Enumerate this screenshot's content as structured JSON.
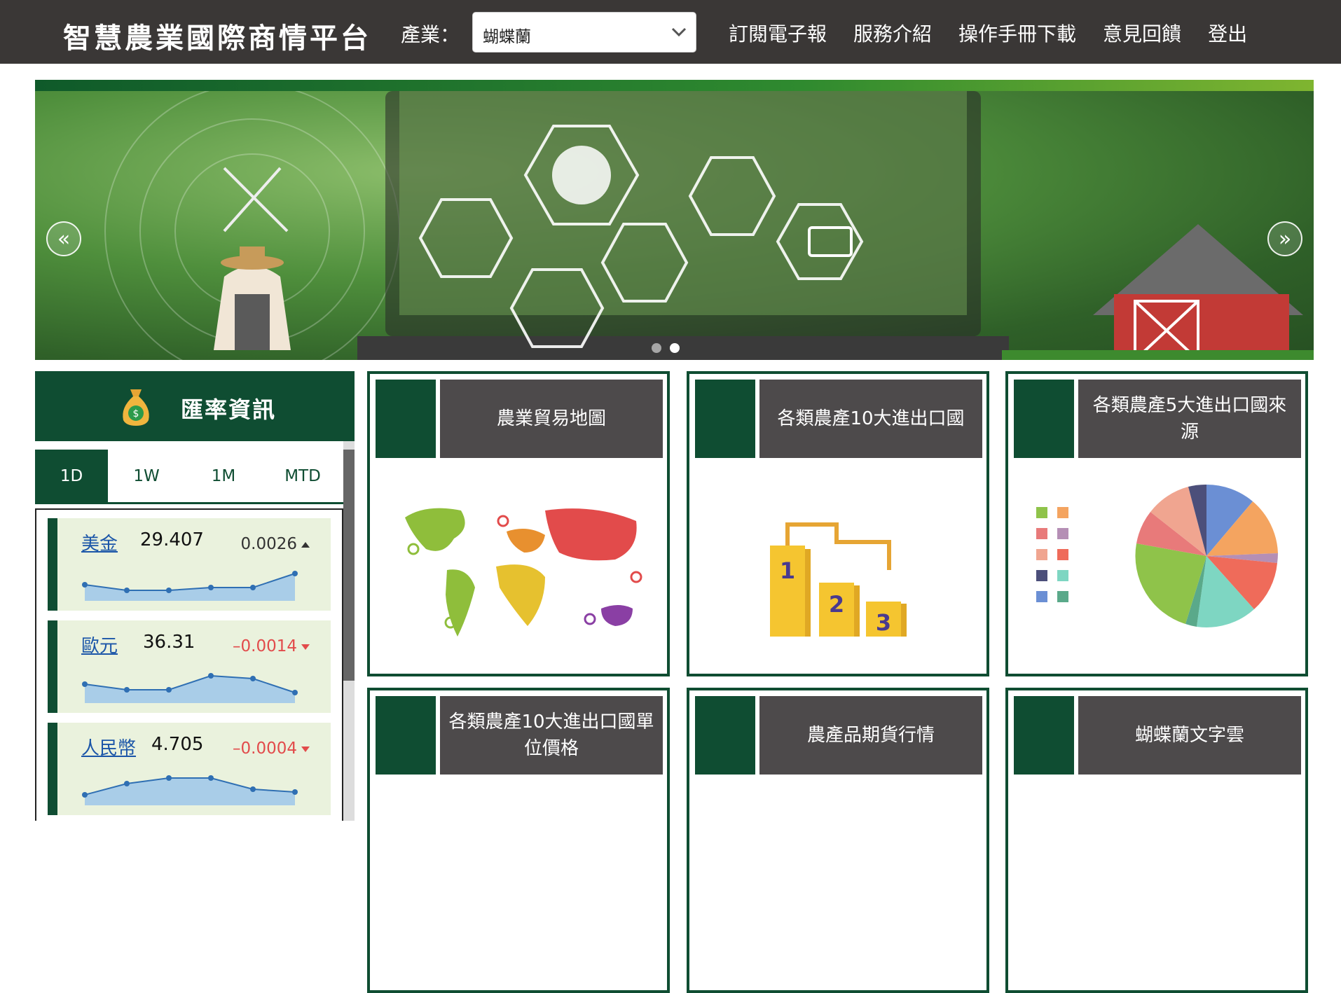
{
  "navbar": {
    "brand": "智慧農業國際商情平台",
    "industry_label": "產業：",
    "industry_value": "蝴蝶蘭",
    "links": [
      "訂閱電子報",
      "服務介紹",
      "操作手冊下載",
      "意見回饋",
      "登出"
    ]
  },
  "carousel": {
    "prev_icon": "«",
    "next_icon": "»",
    "slides": 2,
    "active_slide": 2
  },
  "fx": {
    "title": "匯率資訊",
    "tabs": [
      "1D",
      "1W",
      "1M",
      "MTD"
    ],
    "active_tab": "1D",
    "items": [
      {
        "currency": "美金",
        "rate": "29.407",
        "change": "0.0026",
        "direction": "up",
        "change_color": "#333333",
        "spark": [
          5,
          3,
          3,
          4,
          4,
          9
        ]
      },
      {
        "currency": "歐元",
        "rate": "36.31",
        "change": "–0.0014",
        "direction": "down",
        "change_color": "#e24b4b",
        "spark": [
          6,
          4,
          4,
          9,
          8,
          3
        ]
      },
      {
        "currency": "人民幣",
        "rate": "4.705",
        "change": "–0.0004",
        "direction": "down",
        "change_color": "#e24b4b",
        "spark": [
          3,
          7,
          9,
          9,
          5,
          4
        ]
      }
    ]
  },
  "cards": [
    {
      "title": "農業貿易地圖",
      "icon": "world-map-icon"
    },
    {
      "title": "各類農產10大進出口國",
      "icon": "podium-icon"
    },
    {
      "title": "各類農產5大進出口國來源",
      "icon": "pie-chart-icon"
    },
    {
      "title": "各類農產10大進出口國單位價格",
      "icon": "price-icon"
    },
    {
      "title": "農產品期貨行情",
      "icon": "futures-icon"
    },
    {
      "title": "蝴蝶蘭文字雲",
      "icon": "word-cloud-icon"
    }
  ],
  "podium": [
    "1",
    "2",
    "3"
  ],
  "colors": {
    "brand_green": "#0f4d32",
    "nav_dark": "#3a3736",
    "header_gray": "#4d4a4b"
  }
}
